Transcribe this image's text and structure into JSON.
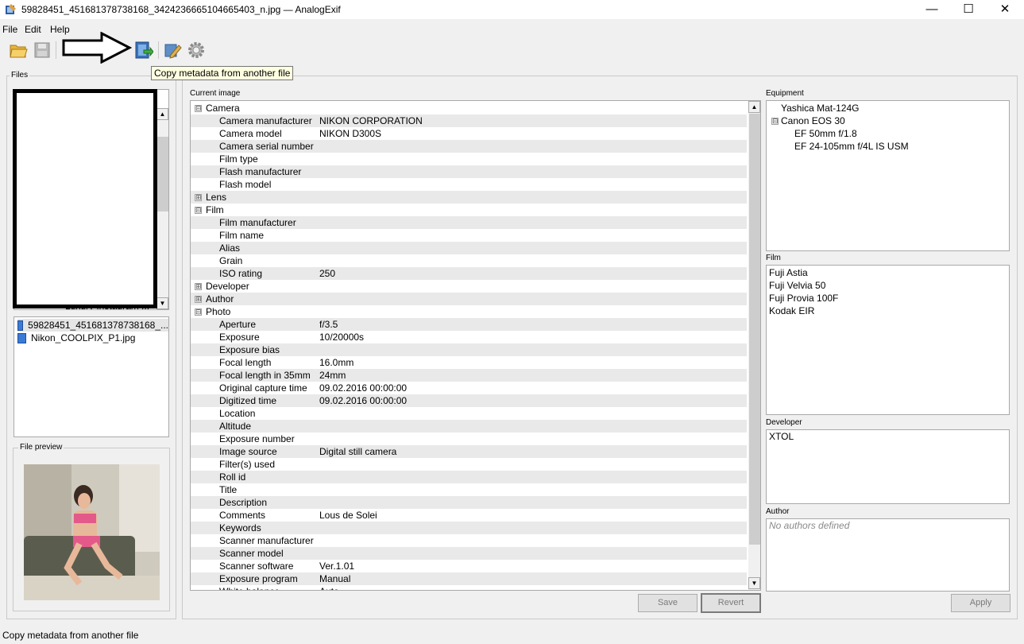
{
  "window": {
    "title": "59828451_451681378738168_3424236665104665403_n.jpg — AnalogExif",
    "minimize_glyph": "—",
    "maximize_glyph": "☐",
    "close_glyph": "✕"
  },
  "menu": [
    "File",
    "Edit",
    "Help"
  ],
  "toolbar": {
    "icons": [
      "open-folder-icon",
      "save-icon",
      "arrow-annotation",
      "copy-metadata-icon",
      "edit-icon",
      "settings-icon"
    ],
    "tooltip": "Copy metadata from another file"
  },
  "files": {
    "group_label": "Files",
    "folder_partial": "Luxury Instagram ...",
    "items": [
      "59828451_451681378738168_...",
      "Nikon_COOLPIX_P1.jpg"
    ],
    "preview_label": "File preview"
  },
  "current": {
    "label": "Current image",
    "rows": [
      {
        "type": "group",
        "label": "Camera",
        "expander": "⊟"
      },
      {
        "type": "field",
        "label": "Camera manufacturer",
        "value": "NIKON CORPORATION"
      },
      {
        "type": "field",
        "label": "Camera model",
        "value": "NIKON D300S"
      },
      {
        "type": "field",
        "label": "Camera serial number",
        "value": ""
      },
      {
        "type": "field",
        "label": "Film type",
        "value": ""
      },
      {
        "type": "field",
        "label": "Flash manufacturer",
        "value": ""
      },
      {
        "type": "field",
        "label": "Flash model",
        "value": ""
      },
      {
        "type": "group",
        "label": "Lens",
        "expander": "⊞"
      },
      {
        "type": "group",
        "label": "Film",
        "expander": "⊟"
      },
      {
        "type": "field",
        "label": "Film manufacturer",
        "value": ""
      },
      {
        "type": "field",
        "label": "Film name",
        "value": ""
      },
      {
        "type": "field",
        "label": "Alias",
        "value": ""
      },
      {
        "type": "field",
        "label": "Grain",
        "value": ""
      },
      {
        "type": "field",
        "label": "ISO rating",
        "value": "250"
      },
      {
        "type": "group",
        "label": "Developer",
        "expander": "⊞"
      },
      {
        "type": "group",
        "label": "Author",
        "expander": "⊞"
      },
      {
        "type": "group",
        "label": "Photo",
        "expander": "⊟"
      },
      {
        "type": "field",
        "label": "Aperture",
        "value": "f/3.5"
      },
      {
        "type": "field",
        "label": "Exposure",
        "value": "10/20000s"
      },
      {
        "type": "field",
        "label": "Exposure bias",
        "value": ""
      },
      {
        "type": "field",
        "label": "Focal length",
        "value": "16.0mm"
      },
      {
        "type": "field",
        "label": "Focal length in 35mm",
        "value": "24mm"
      },
      {
        "type": "field",
        "label": "Original capture time",
        "value": "09.02.2016 00:00:00"
      },
      {
        "type": "field",
        "label": "Digitized time",
        "value": "09.02.2016 00:00:00"
      },
      {
        "type": "field",
        "label": "Location",
        "value": ""
      },
      {
        "type": "field",
        "label": "Altitude",
        "value": ""
      },
      {
        "type": "field",
        "label": "Exposure number",
        "value": ""
      },
      {
        "type": "field",
        "label": "Image source",
        "value": "Digital still camera"
      },
      {
        "type": "field",
        "label": "Filter(s) used",
        "value": ""
      },
      {
        "type": "field",
        "label": "Roll id",
        "value": ""
      },
      {
        "type": "field",
        "label": "Title",
        "value": ""
      },
      {
        "type": "field",
        "label": "Description",
        "value": ""
      },
      {
        "type": "field",
        "label": "Comments",
        "value": "Lous de Solei"
      },
      {
        "type": "field",
        "label": "Keywords",
        "value": ""
      },
      {
        "type": "field",
        "label": "Scanner manufacturer",
        "value": ""
      },
      {
        "type": "field",
        "label": "Scanner model",
        "value": ""
      },
      {
        "type": "field",
        "label": "Scanner software",
        "value": "Ver.1.01"
      },
      {
        "type": "field",
        "label": "Exposure program",
        "value": "Manual"
      },
      {
        "type": "field",
        "label": "White balance",
        "value": "Auto"
      }
    ]
  },
  "equipment": {
    "label": "Equipment",
    "items": [
      {
        "label": "Yashica Mat-124G",
        "level": 0
      },
      {
        "label": "Canon EOS 30",
        "level": 0,
        "expander": "⊟"
      },
      {
        "label": "EF 50mm f/1.8",
        "level": 1
      },
      {
        "label": "EF 24-105mm f/4L IS USM",
        "level": 1
      }
    ]
  },
  "film": {
    "label": "Film",
    "items": [
      "Fuji Astia",
      "Fuji Velvia 50",
      "Fuji Provia 100F",
      "Kodak EIR"
    ]
  },
  "developer": {
    "label": "Developer",
    "items": [
      "XTOL"
    ]
  },
  "author": {
    "label": "Author",
    "placeholder": "No authors defined"
  },
  "buttons": {
    "save": "Save",
    "revert": "Revert",
    "apply": "Apply"
  },
  "status": "Copy metadata from another file"
}
